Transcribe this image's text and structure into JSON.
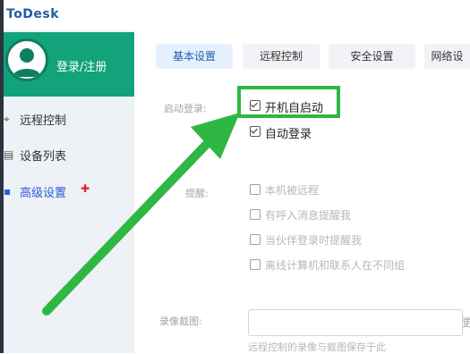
{
  "app": {
    "title": "ToDesk"
  },
  "sidebar": {
    "login_label": "登录/注册",
    "items": [
      {
        "label": "远程控制",
        "icon": "remote-icon"
      },
      {
        "label": "设备列表",
        "icon": "device-icon"
      },
      {
        "label": "高级设置",
        "icon": "settings-icon",
        "active": true,
        "marker": "up-arrow-icon"
      }
    ]
  },
  "tabs": [
    {
      "label": "基本设置",
      "active": true
    },
    {
      "label": "远程控制"
    },
    {
      "label": "安全设置"
    },
    {
      "label": "网络设"
    }
  ],
  "startup": {
    "label": "启动登录:",
    "options": [
      {
        "label": "开机自启动",
        "checked": true
      },
      {
        "label": "自动登录",
        "checked": true
      }
    ]
  },
  "reminders": {
    "label": "提醒:",
    "options": [
      {
        "label": "本机被远程",
        "checked": false
      },
      {
        "label": "有呼入消息提醒我",
        "checked": false
      },
      {
        "label": "当伙伴登录时提醒我",
        "checked": false
      },
      {
        "label": "离线计算机和联系人在不同组",
        "checked": false
      }
    ]
  },
  "recording": {
    "label": "录像截图:",
    "input_value": "",
    "note": "远程控制的录像与截图保存于此",
    "trail": "更"
  },
  "colors": {
    "accent_green": "#12a37a",
    "highlight_green": "#2fb744",
    "brand_blue": "#1f5ea8"
  }
}
